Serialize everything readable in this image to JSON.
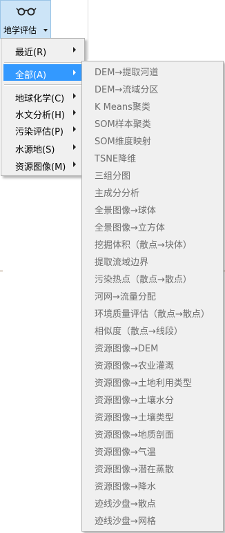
{
  "ribbon": {
    "button_label": "地学评估",
    "icon": "glasses-icon"
  },
  "main_menu": {
    "items": [
      {
        "label": "最近(R)",
        "has_submenu": true,
        "active": false
      },
      {
        "label": "全部(A)",
        "has_submenu": true,
        "active": true
      },
      {
        "label": "地球化学(C)",
        "has_submenu": true,
        "active": false
      },
      {
        "label": "水文分析(H)",
        "has_submenu": true,
        "active": false
      },
      {
        "label": "污染评估(P)",
        "has_submenu": true,
        "active": false
      },
      {
        "label": "水源地(S)",
        "has_submenu": true,
        "active": false
      },
      {
        "label": "资源图像(M)",
        "has_submenu": true,
        "active": false
      }
    ],
    "highlight_color": "#3399ff"
  },
  "submenu": {
    "items": [
      "DEM→提取河道",
      "DEM→流域分区",
      "K Means聚类",
      "SOM样本聚类",
      "SOM维度映射",
      "TSNE降维",
      "三组分图",
      "主成分分析",
      "全景图像→球体",
      "全景图像→立方体",
      "挖掘体积（散点→块体）",
      "提取流域边界",
      "污染热点（散点→散点）",
      "河网→流量分配",
      "环境质量评估（散点→散点）",
      "相似度（散点→线段）",
      "资源图像→DEM",
      "资源图像→农业灌溉",
      "资源图像→土地利用类型",
      "资源图像→土壤水分",
      "资源图像→土壤类型",
      "资源图像→地质剖面",
      "资源图像→气温",
      "资源图像→潜在蒸散",
      "资源图像→降水",
      "迹线沙盘→散点",
      "迹线沙盘→网格"
    ],
    "text_color": "#6d6d6d"
  }
}
